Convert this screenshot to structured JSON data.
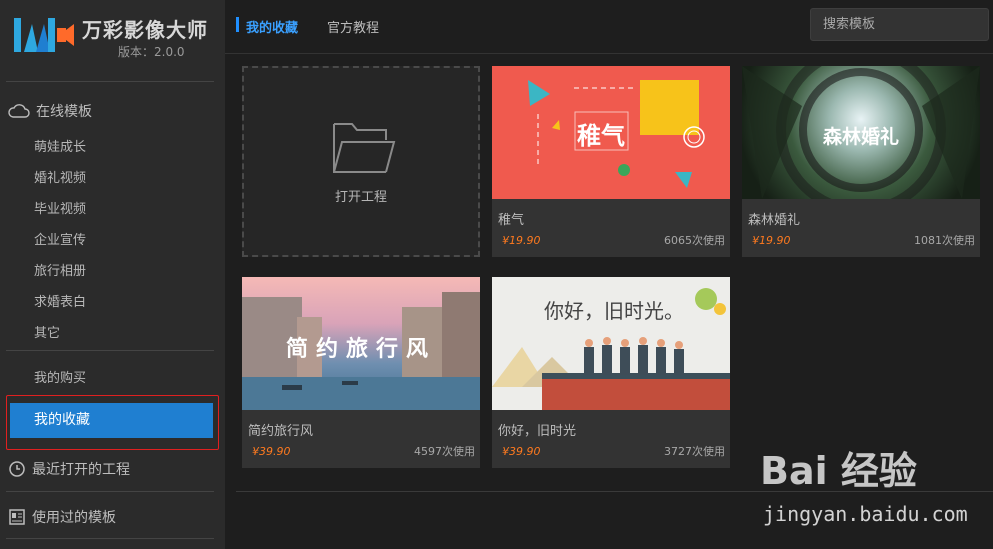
{
  "app": {
    "name": "万彩影像大师",
    "version": "版本：2.0.0"
  },
  "sidebar": {
    "online_templates": "在线模板",
    "categories": [
      "萌娃成长",
      "婚礼视频",
      "毕业视频",
      "企业宣传",
      "旅行相册",
      "求婚表白",
      "其它"
    ],
    "my_purchases": "我的购买",
    "my_favorites": "我的收藏",
    "recent_projects": "最近打开的工程",
    "used_templates": "使用过的模板"
  },
  "tabs": {
    "favorites": "我的收藏",
    "tutorials": "官方教程"
  },
  "search": {
    "placeholder": "搜索模板"
  },
  "open_project": {
    "label": "打开工程"
  },
  "templates": [
    {
      "thumb_text": "稚气",
      "title": "稚气",
      "price": "¥19.90",
      "uses": "6065次使用"
    },
    {
      "thumb_text": "森林婚礼",
      "title": "森林婚礼",
      "price": "¥19.90",
      "uses": "1081次使用"
    },
    {
      "thumb_text": "简约旅行风",
      "title": "简约旅行风",
      "price": "¥39.90",
      "uses": "4597次使用"
    },
    {
      "thumb_text": "你好，旧时光。",
      "title": "你好，旧时光",
      "price": "¥39.90",
      "uses": "3727次使用"
    }
  ],
  "watermark": {
    "brand": "Bai 经验",
    "url": "jingyan.baidu.com"
  },
  "colors": {
    "accent": "#1f7fd1",
    "price": "#ff7a1f",
    "highlight_border": "#e02020"
  }
}
